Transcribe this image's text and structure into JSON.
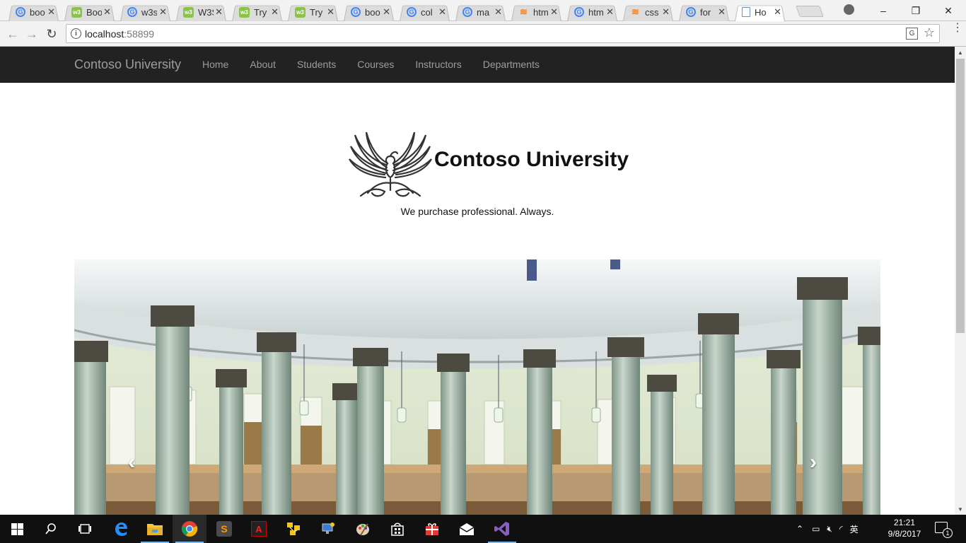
{
  "browser": {
    "tabs": [
      {
        "icon": "google-icon",
        "title": "boo"
      },
      {
        "icon": "w3schools-icon",
        "title": "Boo"
      },
      {
        "icon": "google-icon",
        "title": "w3s"
      },
      {
        "icon": "w3schools-icon",
        "title": "W3S"
      },
      {
        "icon": "w3schools-icon",
        "title": "Try"
      },
      {
        "icon": "w3schools-icon",
        "title": "Try"
      },
      {
        "icon": "google-icon",
        "title": "boo"
      },
      {
        "icon": "google-icon",
        "title": "col"
      },
      {
        "icon": "google-icon",
        "title": "ma"
      },
      {
        "icon": "stackoverflow-icon",
        "title": "htm"
      },
      {
        "icon": "google-icon",
        "title": "htm"
      },
      {
        "icon": "stackoverflow-icon",
        "title": "css"
      },
      {
        "icon": "google-icon",
        "title": "for"
      },
      {
        "icon": "document-icon",
        "title": "Ho",
        "active": true
      }
    ],
    "url_host": "localhost",
    "url_port": ":58899",
    "window_controls": {
      "minimize": "–",
      "restore": "❐",
      "close": "✕"
    }
  },
  "site": {
    "brand": "Contoso University",
    "nav": [
      "Home",
      "About",
      "Students",
      "Courses",
      "Instructors",
      "Departments"
    ],
    "title": "Contoso University",
    "slogan": "We purchase professional. Always."
  },
  "carousel": {
    "prev": "‹",
    "next": "›"
  },
  "taskbar": {
    "time": "21:21",
    "date": "9/8/2017",
    "ime": "英",
    "notifications": "1"
  }
}
